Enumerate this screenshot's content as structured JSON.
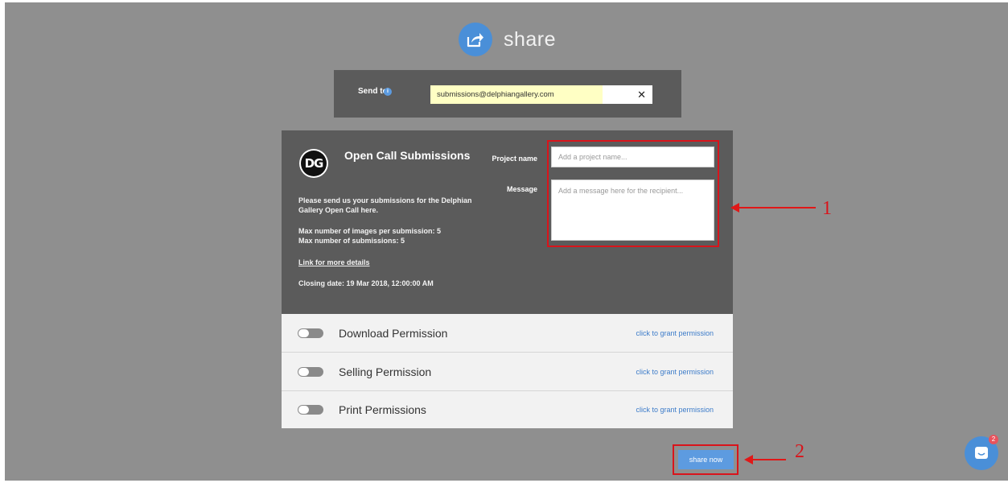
{
  "header": {
    "title": "share",
    "icon": "share-arrow-icon"
  },
  "send_to": {
    "label": "Send to",
    "info_icon": "info-icon",
    "info_glyph": "i",
    "recipient": "submissions@delphiangallery.com",
    "remove_glyph": "✕"
  },
  "submission": {
    "logo_text": "DG",
    "title": "Open Call Submissions",
    "description": "Please send us your submissions for the Delphian Gallery Open Call here.",
    "max_images": "Max number of images per submission: 5",
    "max_submissions": "Max number of submissions: 5",
    "details_link": "Link for more details",
    "closing_date": "Closing date: 19 Mar 2018, 12:00:00 AM"
  },
  "form": {
    "project_name_label": "Project name",
    "project_name_placeholder": "Add a project name...",
    "project_name_value": "",
    "message_label": "Message",
    "message_placeholder": "Add a message here for the recipient...",
    "message_value": ""
  },
  "permissions": [
    {
      "label": "Download Permission",
      "action": "click to grant permission",
      "enabled": false
    },
    {
      "label": "Selling Permission",
      "action": "click to grant permission",
      "enabled": false
    },
    {
      "label": "Print Permissions",
      "action": "click to grant permission",
      "enabled": false
    }
  ],
  "share_button": {
    "label": "share now"
  },
  "annotations": {
    "label1": "1",
    "label2": "2",
    "color": "#d9141b"
  },
  "chat": {
    "badge_count": "2",
    "icon": "chat-bubble-icon"
  },
  "colors": {
    "accent": "#4a8fd8",
    "background": "#8f8f8f",
    "panel": "#5b5b5b",
    "highlight": "#ffffc4"
  }
}
